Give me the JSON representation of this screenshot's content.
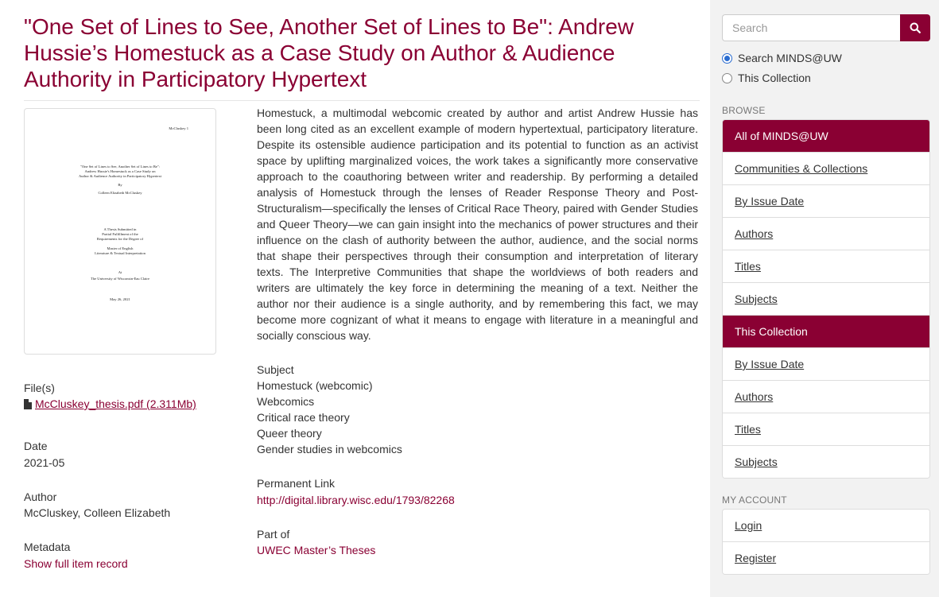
{
  "title": "\"One Set of Lines to See, Another Set of Lines to Be\": Andrew Hussie’s Homestuck as a Case Study on Author & Audience Authority in Participatory Hypertext",
  "thumbnail": {
    "header": "McCluskey 1",
    "title_block": "\"One Set of Lines to See, Another Set of Lines to Be\":\nAndrew Hussie's Homestuck as a Case Study on\nAuthor & Audience Authority in Participatory Hypertext",
    "by": "By",
    "author": "Colleen Elizabeth McCluskey",
    "submitted": "A Thesis Submitted in\nPartial Fulfillment of the\nRequirements for the Degree of",
    "degree": "Master of English\nLiterature & Textual Interpretation",
    "at": "At",
    "institution": "The University of Wisconsin-Eau Claire",
    "date": "May 26, 2021"
  },
  "files": {
    "label": "File(s)",
    "link": "McCluskey_thesis.pdf (2.311Mb)"
  },
  "date": {
    "label": "Date",
    "value": "2021-05"
  },
  "author": {
    "label": "Author",
    "value": "McCluskey, Colleen Elizabeth"
  },
  "metadata": {
    "label": "Metadata",
    "link": "Show full item record"
  },
  "abstract": "Homestuck, a multimodal webcomic created by author and artist Andrew Hussie has been long cited as an excellent example of modern hypertextual, participatory literature. Despite its ostensible audience participation and its potential to function as an activist space by uplifting marginalized voices, the work takes a significantly more conservative approach to the coauthoring between writer and readership. By performing a detailed analysis of Homestuck through the lenses of Reader Response Theory and Post-Structuralism—specifically the lenses of Critical Race Theory, paired with Gender Studies and Queer Theory—we can gain insight into the mechanics of power structures and their influence on the clash of authority between the author, audience, and the social norms that shape their perspectives through their consumption and interpretation of literary texts. The Interpretive Communities that shape the worldviews of both readers and writers are ultimately the key force in determining the meaning of a text. Neither the author nor their audience is a single authority, and by remembering this fact, we may become more cognizant of what it means to engage with literature in a meaningful and socially conscious way.",
  "subject": {
    "label": "Subject",
    "items": [
      "Homestuck (webcomic)",
      "Webcomics",
      "Critical race theory",
      "Queer theory",
      "Gender studies in webcomics"
    ]
  },
  "permanent_link": {
    "label": "Permanent Link",
    "url": "http://digital.library.wisc.edu/1793/82268"
  },
  "part_of": {
    "label": "Part of",
    "link": "UWEC Master’s Theses"
  },
  "sidebar": {
    "search_placeholder": "Search",
    "scope_options": [
      "Search MINDS@UW",
      "This Collection"
    ],
    "browse_heading": "BROWSE",
    "browse_all_header": "All of MINDS@UW",
    "browse_all_items": [
      "Communities & Collections",
      "By Issue Date",
      "Authors",
      "Titles",
      "Subjects"
    ],
    "browse_collection_header": "This Collection",
    "browse_collection_items": [
      "By Issue Date",
      "Authors",
      "Titles",
      "Subjects"
    ],
    "account_heading": "MY ACCOUNT",
    "account_items": [
      "Login",
      "Register"
    ]
  },
  "colors": {
    "accent": "#8a0033",
    "sidebar_bg": "#f2f2f2",
    "radio": "#2a6cd0"
  }
}
